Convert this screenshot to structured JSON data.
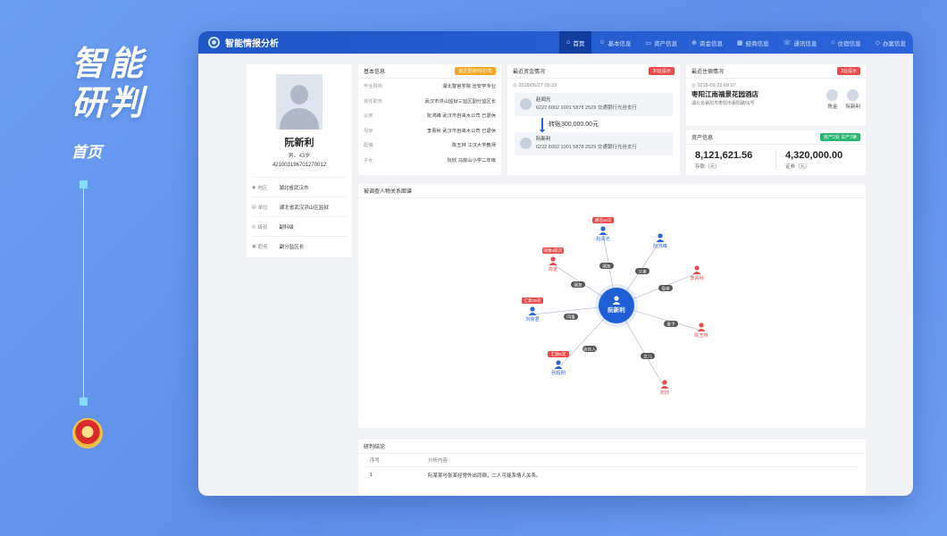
{
  "hero": {
    "title_line1": "智能",
    "title_line2": "研判",
    "subtitle": "首页"
  },
  "app": {
    "title": "智能情报分析",
    "nav": [
      {
        "label": "首页",
        "icon": "⌂",
        "active": true
      },
      {
        "label": "基本信息",
        "icon": "☺",
        "active": false
      },
      {
        "label": "资产信息",
        "icon": "▭",
        "active": false
      },
      {
        "label": "资金信息",
        "icon": "⊕",
        "active": false
      },
      {
        "label": "经商信息",
        "icon": "▦",
        "active": false
      },
      {
        "label": "通讯信息",
        "icon": "☏",
        "active": false
      },
      {
        "label": "住宿信息",
        "icon": "⌂",
        "active": false
      },
      {
        "label": "办案信息",
        "icon": "◇",
        "active": false
      }
    ]
  },
  "profile": {
    "name": "阮新利",
    "meta": "男、43岁",
    "id_number": "421003196701270012",
    "rows": [
      {
        "icon": "◉",
        "label": "地区",
        "value": "湖北省武汉市"
      },
      {
        "icon": "▤",
        "label": "单位",
        "value": "湖北省武汉洪山区监狱"
      },
      {
        "icon": "◎",
        "label": "级别",
        "value": "副科级"
      },
      {
        "icon": "▣",
        "label": "职务",
        "value": "副分监区长"
      }
    ]
  },
  "basic": {
    "title": "基本信息",
    "badge": "最近更新时间7年",
    "rows": [
      {
        "label": "毕业院校",
        "value": "湖北警官学院 治安学专业"
      },
      {
        "label": "现任职务",
        "value": "武汉市洪山监狱三监区副分监区长"
      },
      {
        "label": "父亲",
        "value": "阮鸿峰 武汉市自来水公司 已退休"
      },
      {
        "label": "母亲",
        "value": "李青秋 武汉市自来水公司 已退休"
      },
      {
        "label": "配偶",
        "value": "陈玉林 江汉大学教师"
      },
      {
        "label": "子女",
        "value": "阮欣 马房山小学二年级"
      }
    ]
  },
  "funds": {
    "title": "最近资金情况",
    "badge": "30处提示",
    "time": "2018/05/27 09:33",
    "from": {
      "name": "赵闻光",
      "account": "6222 6002 1001 5878 2529 交通银行光谷支行"
    },
    "transfer": "转账300,000.00元",
    "to": {
      "name": "阮新利",
      "account": "6222 6002 1001 5878 2529 交通银行光谷支行"
    }
  },
  "stay": {
    "title": "最近住宿情况",
    "badge": "2处提示",
    "time": "2018-09-22 09:07",
    "hotel": "枣阳江南福景花园酒店",
    "address": "湖北省襄阳市枣阳市襄阳路56号",
    "persons": [
      "陈金",
      "阮新利"
    ]
  },
  "assets": {
    "title": "资产信息",
    "badge": "房产2处 车产2辆",
    "deposit_value": "8,121,621.56",
    "deposit_label": "存款（元）",
    "securities_value": "4,320,000.00",
    "securities_label": "证券（元）"
  },
  "graph": {
    "title": "被调查人物关系图谱",
    "center": "阮新利",
    "nodes": [
      {
        "name": "赵闻光",
        "relation": "朋友",
        "tag": "通话18次"
      },
      {
        "name": "阮鸿峰",
        "relation": "父亲",
        "tag": ""
      },
      {
        "name": "陈金",
        "relation": "朋友",
        "tag": "同乘4航次"
      },
      {
        "name": "李青秋",
        "relation": "母亲",
        "tag": ""
      },
      {
        "name": "刘奕君",
        "relation": "同事",
        "tag": "汇款16次"
      },
      {
        "name": "陈玉林",
        "relation": "妻子",
        "tag": ""
      },
      {
        "name": "张超刚",
        "relation": "合伙人",
        "tag": "汇款8次"
      },
      {
        "name": "阮欣",
        "relation": "女儿",
        "tag": ""
      }
    ]
  },
  "conclusion": {
    "title": "研判结论",
    "col_index": "序号",
    "col_content": "分析内容",
    "rows": [
      {
        "index": "1",
        "content": "阮某某与张某经常外出同宿，二人可能系情人关系。"
      }
    ]
  }
}
